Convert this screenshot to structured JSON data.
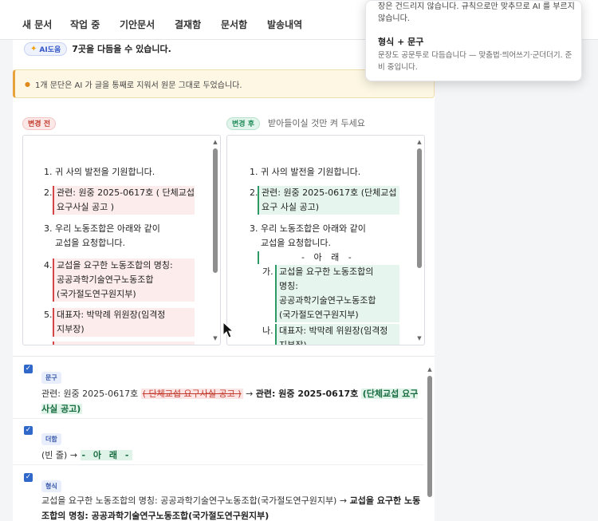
{
  "nav": {
    "tabs": [
      {
        "label": "새 문서"
      },
      {
        "label": "작업 중"
      },
      {
        "label": "기안문서"
      },
      {
        "label": "결재함"
      },
      {
        "label": "문서함"
      },
      {
        "label": "발송내역"
      }
    ]
  },
  "ai": {
    "badge_label": "AI도움",
    "summary": "7곳을 다듬을 수 있습니다."
  },
  "warning": {
    "text": "1개 문단은 AI 가 글을 통째로 지워서 원문 그대로 두었습니다."
  },
  "before": {
    "label": "변경 전",
    "lines": [
      "1. 귀 사의 발전을 기원합니다.",
      "2.",
      "관련: 원중 2025-0617호 ( 단체교섭",
      "요구사실 공고 )",
      "3. 우리 노동조합은 아래와 같이",
      "교섭을 요청합니다.",
      "4.",
      "교섭을 요구한 노동조합의 명칭:",
      "공공과학기술연구노동조합",
      "(국가절도연구원지부)",
      "5.",
      "대표자: 박막례 위원장(임격정",
      "지부장)"
    ]
  },
  "after": {
    "label": "변경 후",
    "hint": "받아들이실 것만 켜 두세요",
    "lines": [
      "1. 귀 사의 발전을 기원합니다.",
      "2.",
      "관련: 원중 2025-0617호 (단체교섭",
      "요구 사실 공고)",
      "3. 우리 노동조합은 아래와 같이",
      "교섭을 요청합니다.",
      "- 아 래 -",
      "가.",
      "교섭을 요구한 노동조합의",
      "명칭:",
      "공공과학기술연구노동조합",
      "(국가절도연구원지부)",
      "나.",
      "대표자: 박막례 위원장(임격정",
      "지부장)"
    ]
  },
  "changes": [
    {
      "tag": "문구",
      "checked": "✓",
      "prefix": "관련: 원중 2025-0617호 ",
      "del_parts": [
        "( 단체교섭",
        "요구사실",
        "공고",
        ")"
      ],
      "arrow": " → ",
      "after_strong": "관련: 원중 2025-0617호",
      "ins": "(단체교섭 요구 사실 공고)"
    },
    {
      "tag": "더함",
      "checked": "✓",
      "prefix": "(빈 줄) → ",
      "ins": "- 아 래 -"
    },
    {
      "tag": "형식",
      "checked": "✓",
      "prefix": "교섭을 요구한 노동조합의 명칭: 공공과학기술연구노동조합(국가절도연구원지부) → ",
      "after_strong": "교섭을 요구한 노동조합의 명칭: 공공과학기술연구노동조합(국가절도연구원지부)"
    }
  ],
  "popover": {
    "top_text": "장은 건드리지 않습니다. 규칙으로만 맞추므로 AI 를 부르지 않습니다.",
    "title": "형식 + 문구",
    "body_text": "문장도 공문투로 다듬습니다 — 맞춤법·띄어쓰기·군더더기. 준비 중입니다."
  },
  "colors": {
    "accent": "#2f68c8",
    "removed": "#d64545",
    "added": "#2d9a66",
    "warning": "#e9a23b"
  }
}
